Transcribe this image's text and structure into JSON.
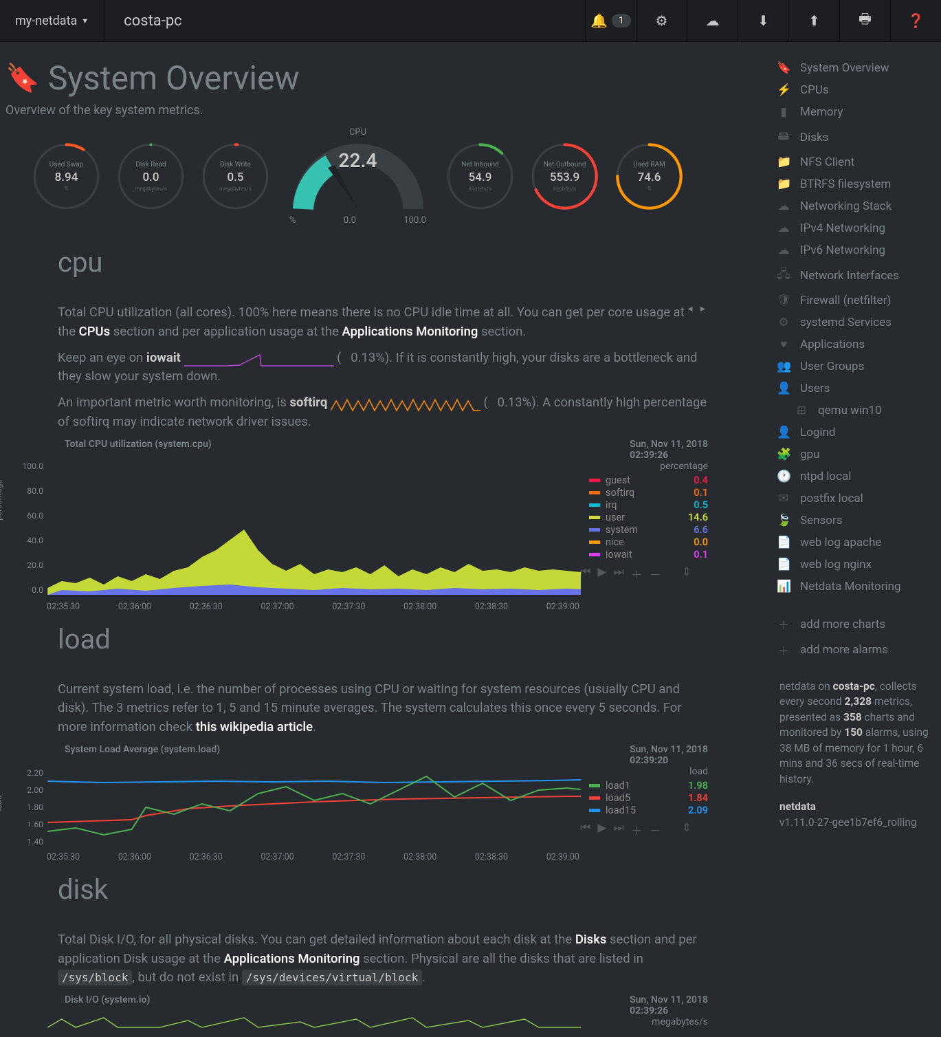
{
  "topbar": {
    "brand": "my-netdata",
    "hostname": "costa-pc",
    "notif_count": "1"
  },
  "page": {
    "title": "System Overview",
    "subtitle": "Overview of the key system metrics."
  },
  "gauges": {
    "big_title": "CPU",
    "big_value": "22.4",
    "scale_min": "0.0",
    "scale_max": "100.0",
    "scale_unit": "%",
    "small": [
      {
        "label": "Used Swap",
        "value": "8.94",
        "unit": "%",
        "color": "#ff5722",
        "pct": 9
      },
      {
        "label": "Disk Read",
        "value": "0.0",
        "unit": "megabytes/s",
        "color": "#4caf50",
        "pct": 0
      },
      {
        "label": "Disk Write",
        "value": "0.5",
        "unit": "megabytes/s",
        "color": "#f44336",
        "pct": 1
      },
      {
        "label": "Net Inbound",
        "value": "54.9",
        "unit": "kilobits/s",
        "color": "#4caf50",
        "pct": 12
      },
      {
        "label": "Net Outbound",
        "value": "553.9",
        "unit": "kilobits/s",
        "color": "#f44336",
        "pct": 68
      },
      {
        "label": "Used RAM",
        "value": "74.6",
        "unit": "%",
        "color": "#ff9800",
        "pct": 75
      }
    ]
  },
  "cpu": {
    "heading": "cpu",
    "desc1_a": "Total CPU utilization (all cores). 100% here means there is no CPU idle time at all. You can get per core usage at the ",
    "desc1_link1": "CPUs",
    "desc1_b": " section and per application usage at the ",
    "desc1_link2": "Applications Monitoring",
    "desc1_c": " section.",
    "desc2_a": "Keep an eye on ",
    "desc2_term": "iowait",
    "desc2_b": " (",
    "desc2_pct": "0.13%",
    "desc2_c": "). If it is constantly high, your disks are a bottleneck and they slow your system down.",
    "desc3_a": "An important metric worth monitoring, is ",
    "desc3_term": "softirq",
    "desc3_b": " (",
    "desc3_pct": "0.13%",
    "desc3_c": "). A constantly high percentage of softirq may indicate network driver issues.",
    "chart_title": "Total CPU utilization (system.cpu)",
    "chart_date": "Sun, Nov 11, 2018",
    "chart_time": "02:39:26",
    "yaxis_label": "percentage",
    "legend_title": "percentage",
    "legend": [
      {
        "name": "guest",
        "value": "0.4",
        "color": "#ff1744"
      },
      {
        "name": "softirq",
        "value": "0.1",
        "color": "#ff6d00"
      },
      {
        "name": "irq",
        "value": "0.5",
        "color": "#00bcd4"
      },
      {
        "name": "user",
        "value": "14.6",
        "color": "#cddc39"
      },
      {
        "name": "system",
        "value": "6.6",
        "color": "#6773e6"
      },
      {
        "name": "nice",
        "value": "0.0",
        "color": "#ff9800"
      },
      {
        "name": "iowait",
        "value": "0.1",
        "color": "#e040fb"
      }
    ],
    "yticks": [
      "100.0",
      "80.0",
      "60.0",
      "40.0",
      "20.0",
      "0.0"
    ],
    "xticks": [
      "02:35:30",
      "02:36:00",
      "02:36:30",
      "02:37:00",
      "02:37:30",
      "02:38:00",
      "02:38:30",
      "02:39:00"
    ]
  },
  "load": {
    "heading": "load",
    "desc_a": "Current system load, i.e. the number of processes using CPU or waiting for system resources (usually CPU and disk). The 3 metrics refer to 1, 5 and 15 minute averages. The system calculates this once every 5 seconds. For more information check ",
    "desc_link": "this wikipedia article",
    "desc_b": ".",
    "chart_title": "System Load Average (system.load)",
    "chart_date": "Sun, Nov 11, 2018",
    "chart_time": "02:39:20",
    "yaxis_label": "load",
    "legend_title": "load",
    "legend": [
      {
        "name": "load1",
        "value": "1.98",
        "color": "#4caf50"
      },
      {
        "name": "load5",
        "value": "1.84",
        "color": "#f44336"
      },
      {
        "name": "load15",
        "value": "2.09",
        "color": "#2196f3"
      }
    ],
    "yticks": [
      "2.20",
      "2.00",
      "1.80",
      "1.60",
      "1.40"
    ],
    "xticks": [
      "02:35:30",
      "02:36:00",
      "02:36:30",
      "02:37:00",
      "02:37:30",
      "02:38:00",
      "02:38:30",
      "02:39:00"
    ]
  },
  "disk": {
    "heading": "disk",
    "desc_a": "Total Disk I/O, for all physical disks. You can get detailed information about each disk at the ",
    "desc_link1": "Disks",
    "desc_b": " section and per application Disk usage at the ",
    "desc_link2": "Applications Monitoring",
    "desc_c": " section. Physical are all the disks that are listed in ",
    "code1": "/sys/block",
    "desc_d": ", but do not exist in ",
    "code2": "/sys/devices/virtual/block",
    "desc_e": ".",
    "chart_title": "Disk I/O (system.io)",
    "chart_date": "Sun, Nov 11, 2018",
    "chart_time": "02:39:26",
    "legend_title": "megabytes/s"
  },
  "sidebar": {
    "items": [
      {
        "icon": "🔖",
        "label": "System Overview"
      },
      {
        "icon": "⚡",
        "label": "CPUs"
      },
      {
        "icon": "▮",
        "label": "Memory"
      },
      {
        "icon": "🖴",
        "label": "Disks"
      },
      {
        "icon": "📁",
        "label": "NFS Client"
      },
      {
        "icon": "📁",
        "label": "BTRFS filesystem"
      },
      {
        "icon": "☁",
        "label": "Networking Stack"
      },
      {
        "icon": "☁",
        "label": "IPv4 Networking"
      },
      {
        "icon": "☁",
        "label": "IPv6 Networking"
      },
      {
        "icon": "🖧",
        "label": "Network Interfaces"
      },
      {
        "icon": "🛡",
        "label": "Firewall (netfilter)"
      },
      {
        "icon": "⚙",
        "label": "systemd Services"
      },
      {
        "icon": "♥",
        "label": "Applications"
      },
      {
        "icon": "👥",
        "label": "User Groups"
      },
      {
        "icon": "👤",
        "label": "Users"
      },
      {
        "icon": "⊞",
        "label": "qemu win10",
        "indent": true
      },
      {
        "icon": "👤",
        "label": "Logind"
      },
      {
        "icon": "🧩",
        "label": "gpu"
      },
      {
        "icon": "🕐",
        "label": "ntpd local"
      },
      {
        "icon": "✉",
        "label": "postfix local"
      },
      {
        "icon": "🍃",
        "label": "Sensors"
      },
      {
        "icon": "📄",
        "label": "web log apache"
      },
      {
        "icon": "📄",
        "label": "web log nginx"
      },
      {
        "icon": "📊",
        "label": "Netdata Monitoring"
      }
    ],
    "add_charts": "add more charts",
    "add_alarms": "add more alarms",
    "footer_a": "netdata on ",
    "footer_host": "costa-pc",
    "footer_b": ", collects every second ",
    "footer_metrics": "2,328",
    "footer_c": " metrics, presented as ",
    "footer_charts": "358",
    "footer_d": " charts and monitored by ",
    "footer_alarms": "150",
    "footer_e": " alarms, using 38 MB of memory for 1 hour, 6 mins and 36 secs of real-time history.",
    "ver_label": "netdata",
    "version": "v1.11.0-27-gee1b7ef6_rolling"
  },
  "chart_data": [
    {
      "id": "system.cpu",
      "type": "area",
      "stacked": true,
      "title": "Total CPU utilization (system.cpu)",
      "ylabel": "percentage",
      "ylim": [
        0,
        100
      ],
      "x_range": [
        "02:35:30",
        "02:39:26"
      ],
      "snapshot_time": "02:39:26",
      "series": [
        {
          "name": "guest",
          "value": 0.4,
          "color": "#ff1744"
        },
        {
          "name": "softirq",
          "value": 0.1,
          "color": "#ff6d00"
        },
        {
          "name": "irq",
          "value": 0.5,
          "color": "#00bcd4"
        },
        {
          "name": "user",
          "value": 14.6,
          "color": "#cddc39"
        },
        {
          "name": "system",
          "value": 6.6,
          "color": "#6773e6"
        },
        {
          "name": "nice",
          "value": 0.0,
          "color": "#ff9800"
        },
        {
          "name": "iowait",
          "value": 0.1,
          "color": "#e040fb"
        }
      ],
      "approx_total_range": [
        12,
        55
      ]
    },
    {
      "id": "system.load",
      "type": "line",
      "title": "System Load Average (system.load)",
      "ylabel": "load",
      "ylim": [
        1.4,
        2.2
      ],
      "x_range": [
        "02:35:30",
        "02:39:20"
      ],
      "snapshot_time": "02:39:20",
      "series": [
        {
          "name": "load1",
          "value": 1.98,
          "approx_range": [
            1.45,
            2.2
          ],
          "color": "#4caf50"
        },
        {
          "name": "load5",
          "value": 1.84,
          "approx_range": [
            1.65,
            1.9
          ],
          "color": "#f44336"
        },
        {
          "name": "load15",
          "value": 2.09,
          "approx_range": [
            2.05,
            2.12
          ],
          "color": "#2196f3"
        }
      ]
    }
  ]
}
